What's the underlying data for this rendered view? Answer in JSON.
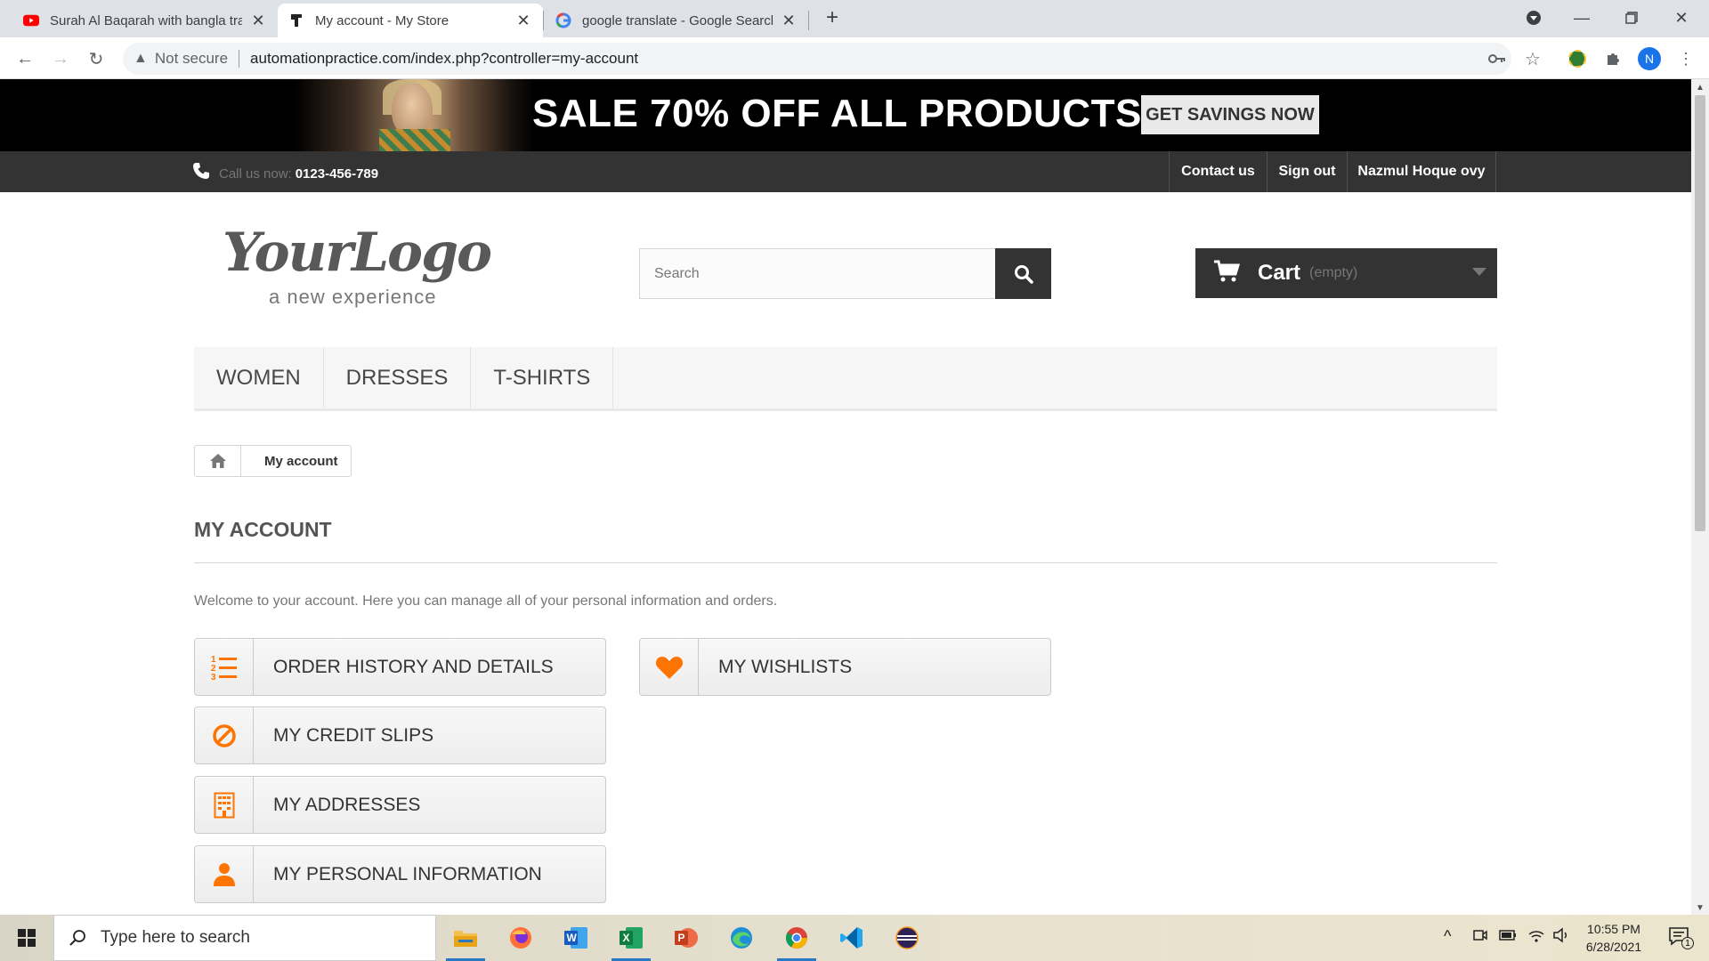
{
  "browser": {
    "tabs": [
      {
        "title": "Surah Al Baqarah with bangla tra",
        "favicon": "youtube-icon",
        "active": false
      },
      {
        "title": "My account - My Store",
        "favicon": "store-icon",
        "active": true
      },
      {
        "title": "google translate - Google Search",
        "favicon": "google-icon",
        "active": false
      }
    ],
    "security_label": "Not secure",
    "url": "automationpractice.com/index.php?controller=my-account",
    "profile_initial": "N"
  },
  "banner": {
    "sale_text": "SALE 70% OFF ALL PRODUCTS",
    "cta_label": "GET SAVINGS NOW"
  },
  "topnav": {
    "call_label": "Call us now:",
    "phone": "0123-456-789",
    "links": [
      "Contact us",
      "Sign out",
      "Nazmul Hoque ovy"
    ]
  },
  "header": {
    "logo_script": "YourLogo",
    "logo_tagline": "a new experience",
    "search_placeholder": "Search",
    "cart_label": "Cart",
    "cart_status": "(empty)"
  },
  "menu": [
    "Women",
    "Dresses",
    "T-shirts"
  ],
  "breadcrumb": {
    "current": "My account"
  },
  "account": {
    "heading": "My account",
    "welcome": "Welcome to your account. Here you can manage all of your personal information and orders.",
    "buttons": [
      {
        "label": "Order history and details",
        "icon": "list-ordered-icon"
      },
      {
        "label": "My credit slips",
        "icon": "ban-icon"
      },
      {
        "label": "My addresses",
        "icon": "building-icon"
      },
      {
        "label": "My personal information",
        "icon": "user-icon"
      },
      {
        "label": "My wishlists",
        "icon": "heart-icon"
      }
    ],
    "accent_color": "#f13340",
    "icon_color": "#fe7400"
  },
  "taskbar": {
    "search_placeholder": "Type here to search",
    "time": "10:55 PM",
    "date": "6/28/2021",
    "notification_count": "1"
  }
}
